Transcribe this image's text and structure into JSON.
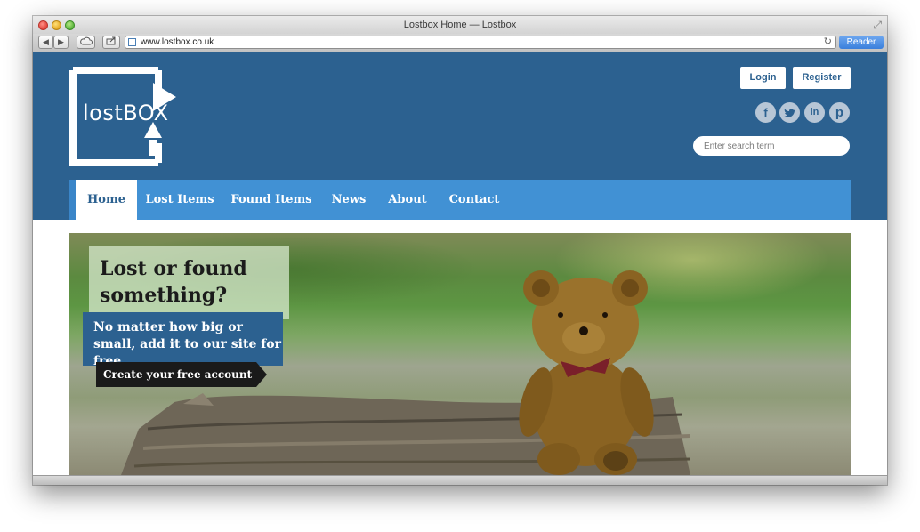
{
  "browser": {
    "title": "Lostbox Home — Lostbox",
    "url": "www.lostbox.co.uk",
    "reader_label": "Reader"
  },
  "header": {
    "logo_text": "lostBOX",
    "login_label": "Login",
    "register_label": "Register",
    "social_icons": [
      "facebook-icon",
      "twitter-icon",
      "linkedin-icon",
      "pinterest-icon"
    ],
    "search_placeholder": "Enter search term"
  },
  "nav": {
    "items": [
      {
        "label": "Home",
        "active": true
      },
      {
        "label": "Lost Items",
        "active": false
      },
      {
        "label": "Found Items",
        "active": false
      },
      {
        "label": "News",
        "active": false
      },
      {
        "label": "About",
        "active": false
      },
      {
        "label": "Contact",
        "active": false
      }
    ]
  },
  "hero": {
    "title": "Lost or found something?",
    "subtitle": "No matter how big or small, add it to our site for free.",
    "cta_label": "Create your free account"
  },
  "colors": {
    "header_blue": "#2c6190",
    "nav_blue": "#4191d4"
  }
}
